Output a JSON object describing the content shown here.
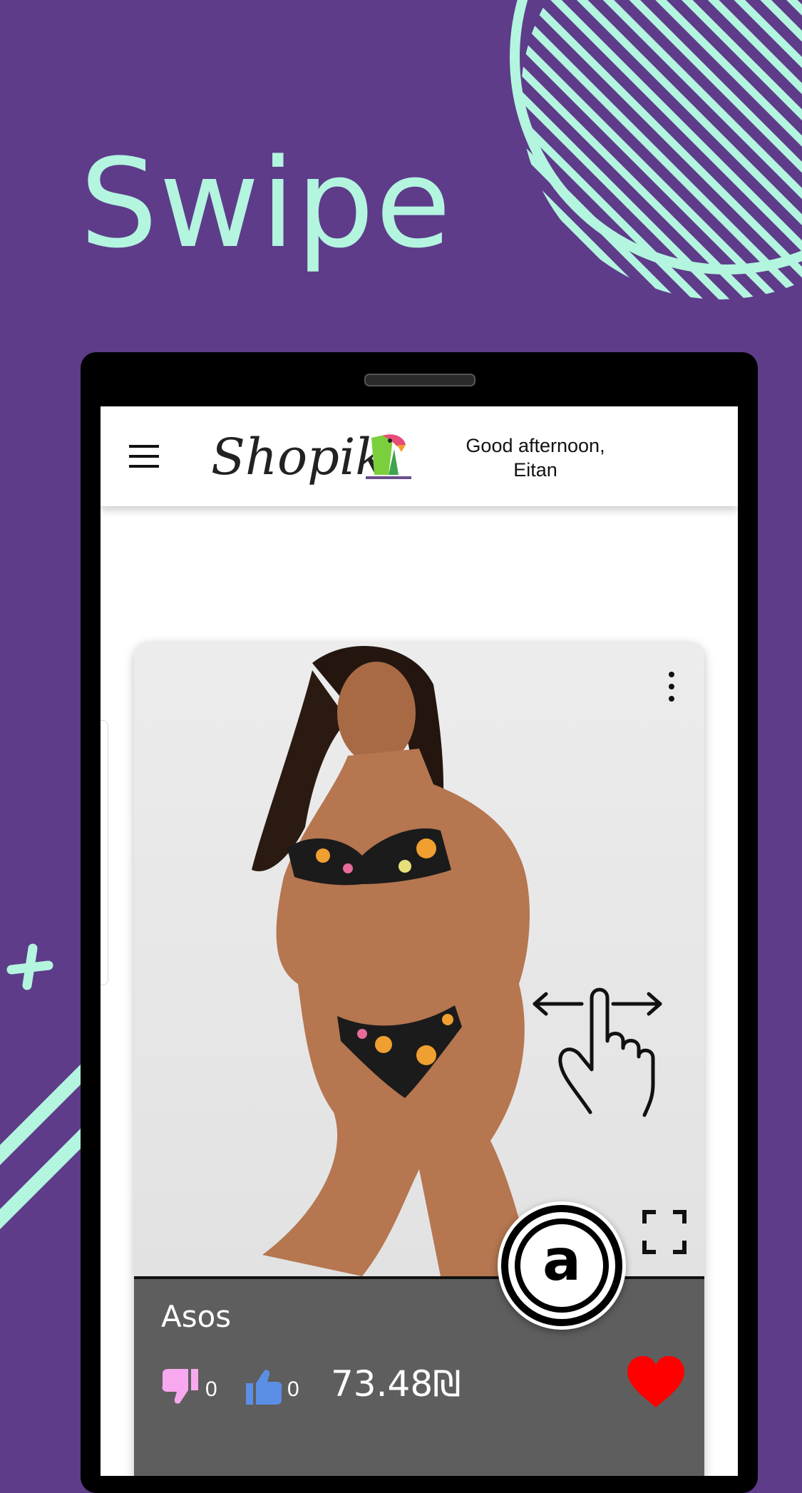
{
  "headline": "Swipe",
  "colors": {
    "background": "#5e3c8a",
    "accent": "#b3f5df",
    "heart": "#ff0000",
    "dislike": "#f7a8ee",
    "like": "#5b8fe6",
    "info_panel": "#5e5e5e"
  },
  "app_bar": {
    "menu_icon": "hamburger-menu-icon",
    "logo_text": "Shopik",
    "logo_icon": "parrot-logo-icon",
    "greeting_line1": "Good afternoon,",
    "greeting_line2": "Eitan"
  },
  "card": {
    "image_subject": "model-in-floral-bikini",
    "menu_icon": "kebab-menu-icon",
    "expand_icon": "fullscreen-expand-icon",
    "gesture_icon": "swipe-hand-gesture-icon",
    "store_badge_icon": "asos-logo-icon",
    "store_badge_letter": "a",
    "brand": "Asos",
    "dislike_count": "0",
    "like_count": "0",
    "price": "73.48₪",
    "favorite_icon": "heart-icon"
  }
}
